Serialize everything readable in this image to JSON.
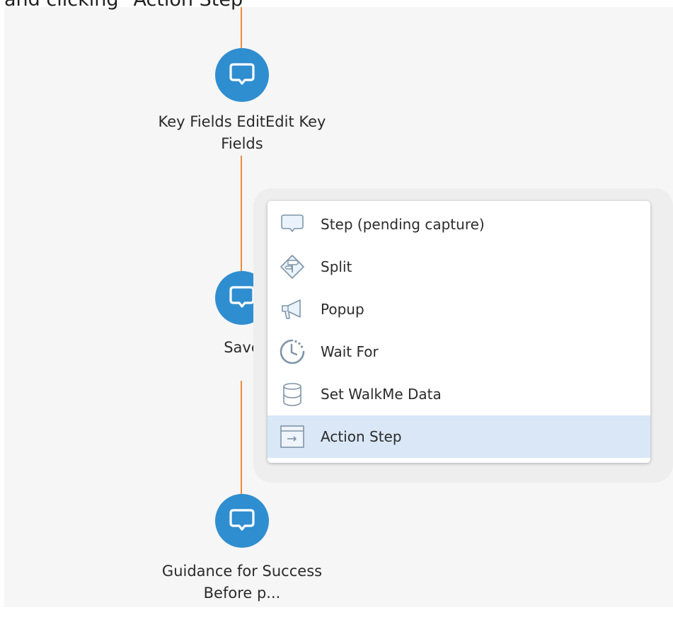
{
  "caption": "and clicking \"Action Step\"",
  "flow": {
    "nodes": [
      {
        "label": "Key Fields EditEdit Key Fields",
        "icon": "speech-bubble-icon"
      },
      {
        "label": "Save",
        "icon": "speech-bubble-icon"
      },
      {
        "label": "Guidance for Success Before p...",
        "icon": "speech-bubble-icon"
      }
    ]
  },
  "menu": {
    "items": [
      {
        "label": "Step (pending capture)",
        "icon": "speech-bubble-outline-icon"
      },
      {
        "label": "Split",
        "icon": "split-diamond-icon"
      },
      {
        "label": "Popup",
        "icon": "megaphone-icon"
      },
      {
        "label": "Wait For",
        "icon": "clock-icon"
      },
      {
        "label": "Set WalkMe Data",
        "icon": "database-icon"
      },
      {
        "label": "Action Step",
        "icon": "action-step-icon"
      }
    ],
    "highlighted_item": "Action Step"
  },
  "colors": {
    "node": "#2f8ed0",
    "connector": "#ea8a3d",
    "canvas": "#f6f6f6",
    "menu_highlight": "#d9e7f6",
    "menu_icon": "#7f95a8"
  }
}
